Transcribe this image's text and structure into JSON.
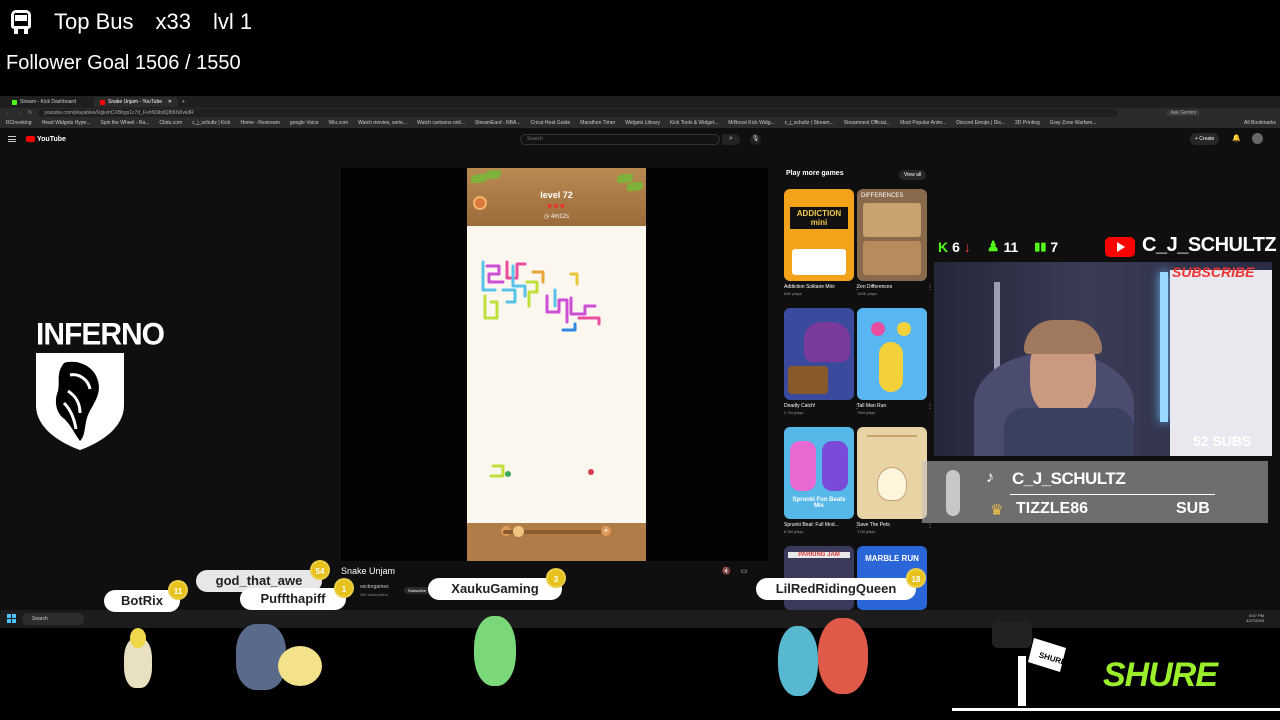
{
  "overlay": {
    "bus_title": "Top Bus",
    "bus_multiplier": "x33",
    "bus_level": "lvl 1",
    "follower_goal": "Follower Goal 1506 / 1550"
  },
  "browser": {
    "tabs": [
      {
        "label": "Stream - Kick Dashboard",
        "color": "#53fc18"
      },
      {
        "label": "Snake Unjam - YouTube",
        "color": "#ff0000"
      }
    ],
    "url": "youtube.com/playables/UgkxhCXBbgs1c7d_FuhN3ibdQ8tKN0vkdR",
    "ask_gemini": "Ask Gemini",
    "bookmarks": [
      "RCinvoking",
      "Heart Widgets Hype...",
      "Spin the Wheel - Ra...",
      "Cbdu.com",
      "c_j_schultz | Kick",
      "Home - Restream",
      "google Voice",
      "Wiu.com",
      "Watch movies, serie...",
      "Watch cartoons onli...",
      "StreamEard - NBA...",
      "Cricut Heat Guide",
      "Marathon Timer",
      "Widgets Library",
      "Kick Tools & Widget...",
      "MrBoost Kick Widg...",
      "c_j_schultz | Stream...",
      "Streamnest Official...",
      "Most Popular Anim...",
      "Discord Emojis | Dis...",
      "3D Printing",
      "Gray Zone Warfare..."
    ],
    "all_bookmarks": "All Bookmarks"
  },
  "youtube": {
    "logo": "YouTube",
    "search_placeholder": "Search",
    "create": "+ Create",
    "video_title": "Snake Unjam",
    "channel": "vectorgames",
    "channel_subs": "460 subscribers",
    "subscribe": "Subscribe",
    "game": {
      "level": "level 72",
      "hearts": "♥♥♥",
      "timer": "◷ 4m12s"
    },
    "play_more": {
      "title": "Play more games",
      "view_all": "View all",
      "games": [
        {
          "name": "Addiction Solitaire Mini",
          "plays": "69K plays",
          "thumb_text": "ADDICTION mini",
          "bg": "#f2a319"
        },
        {
          "name": "Zen Differences",
          "plays": "145K plays",
          "thumb_text": "DIFFERENCES",
          "bg": "#8a6a4c"
        },
        {
          "name": "Deadly Catch!",
          "plays": "2.7M plays",
          "thumb_text": "",
          "bg": "#3a4a9c"
        },
        {
          "name": "Tall Man Run",
          "plays": "76M plays",
          "thumb_text": "",
          "bg": "#58b6f0"
        },
        {
          "name": "Sprunki Beat: Full Mod...",
          "plays": "6.3M plays",
          "thumb_text": "Sprunki Fun Beats Mix",
          "bg": "#56b8e8"
        },
        {
          "name": "Save The Pets",
          "plays": "17M plays",
          "thumb_text": "",
          "bg": "#e8d3a5"
        },
        {
          "name": "",
          "plays": "",
          "thumb_text": "PARKING JAM",
          "bg": "#3a3a5c"
        },
        {
          "name": "",
          "plays": "",
          "thumb_text": "MARBLE RUN",
          "bg": "#2a66d8"
        }
      ]
    }
  },
  "brand": {
    "inferno": "INFERNO"
  },
  "stream_panel": {
    "kick_followers": "6",
    "kick_followers_trend": "↓",
    "viewers": "11",
    "rank": "7",
    "youtube_name": "C_J_SCHULTZ",
    "subs": "52 SUBS",
    "tiktok_name": "C_J_SCHULTZ",
    "latest_sub": "TIZZLE86",
    "sub_label": "SUB",
    "subscribe_sign": "SUBSCRIBE"
  },
  "taskbar": {
    "search": "Search",
    "time": "5:57 PM",
    "date": "4/27/2025"
  },
  "chat": [
    {
      "name": "BotRix",
      "badge": "11"
    },
    {
      "name": "god_that_awe",
      "badge": "54"
    },
    {
      "name": "Puffthapiff",
      "badge": "1"
    },
    {
      "name": "XaukuGaming",
      "badge": "3"
    },
    {
      "name": "LilRedRidingQueen",
      "badge": "18"
    }
  ],
  "sponsor": {
    "shure": "SHURE",
    "mic_label": "SHURE"
  },
  "colors": {
    "kick_green": "#53fc18",
    "youtube_red": "#ff0000",
    "shure_green": "#9bef2a",
    "badge_gold": "#e8c21c"
  }
}
